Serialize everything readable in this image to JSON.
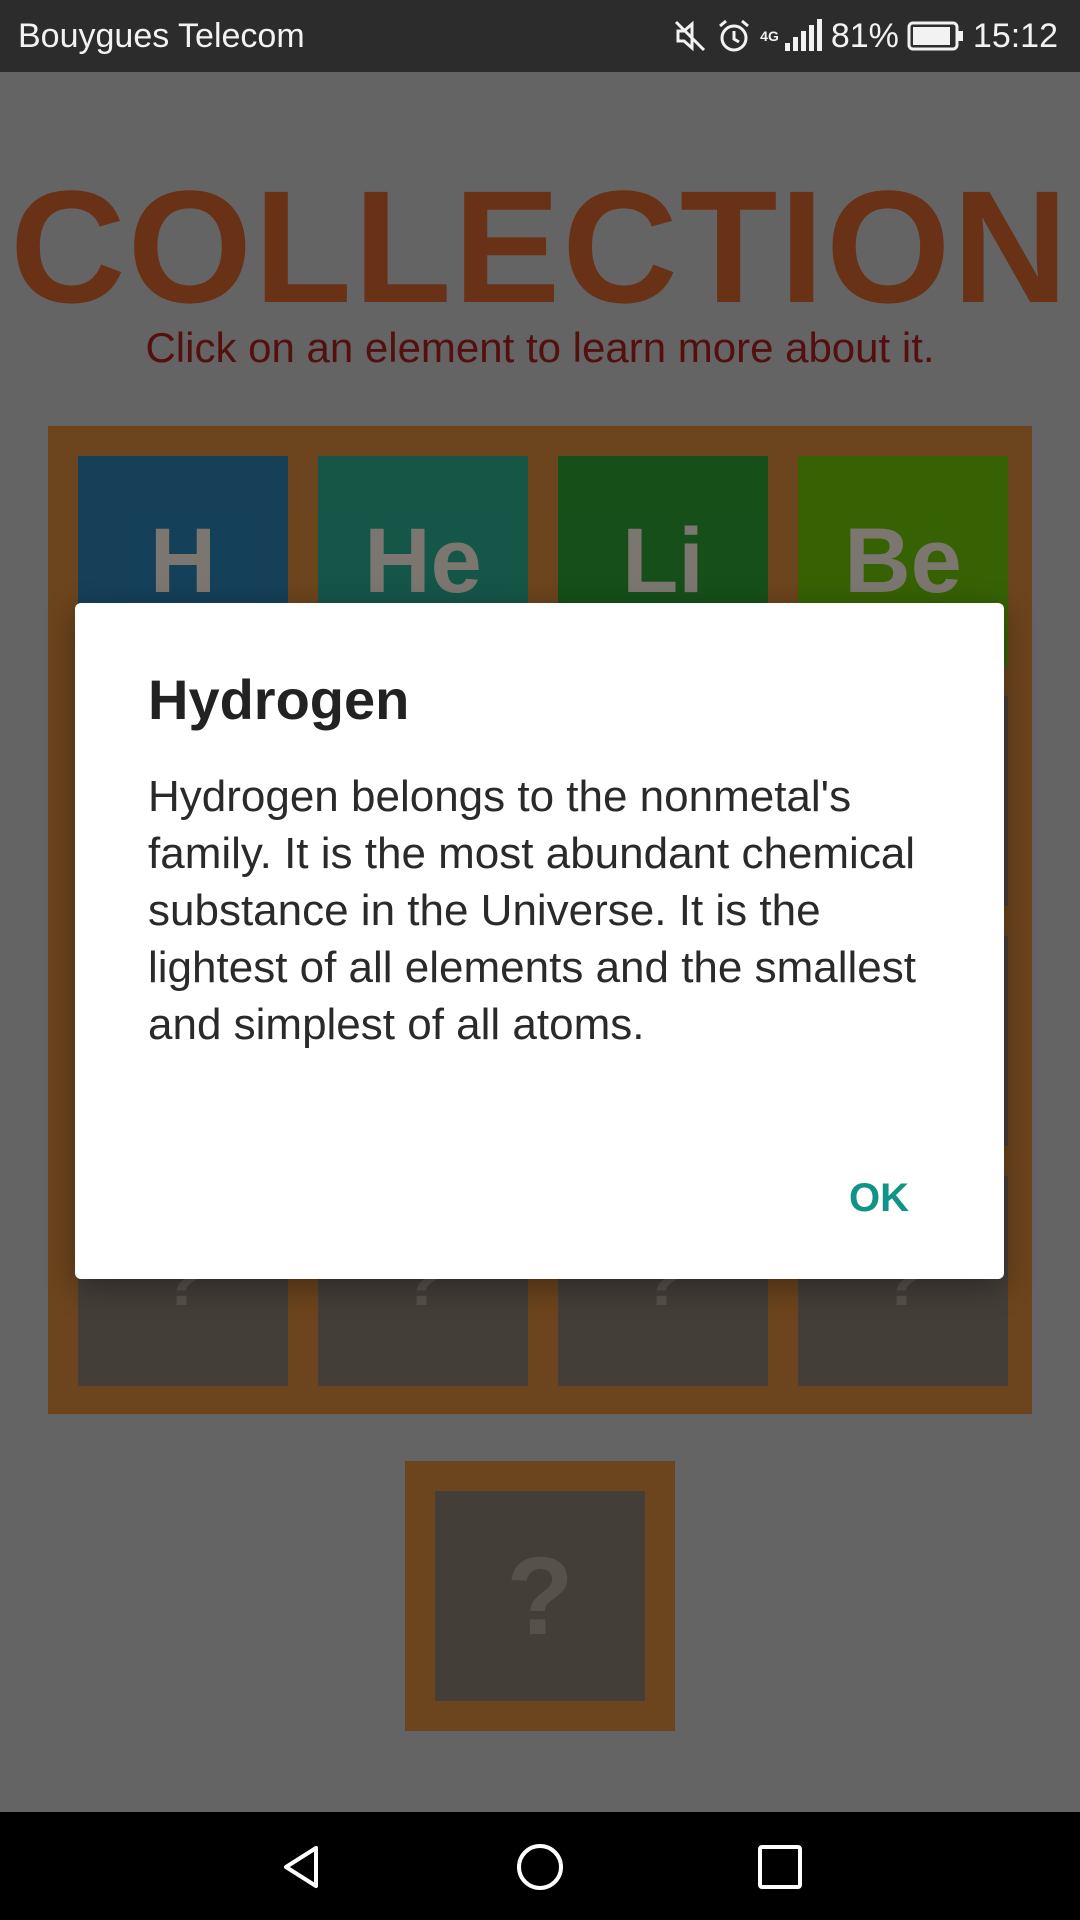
{
  "status_bar": {
    "carrier": "Bouygues Telecom",
    "network": "4G",
    "battery": "81%",
    "time": "15:12",
    "icons": [
      "mute-icon",
      "alarm-icon",
      "signal-icon",
      "battery-icon"
    ]
  },
  "screen": {
    "title": "COLLECTION",
    "subtitle": "Click on an element to learn more about it.",
    "elements": [
      {
        "symbol": "H",
        "color": "#0b7fc7"
      },
      {
        "symbol": "He",
        "color": "#0ab39f"
      },
      {
        "symbol": "Li",
        "color": "#0fa332"
      },
      {
        "symbol": "Be",
        "color": "#5ad000"
      }
    ],
    "unknown_symbol": "?",
    "colors": {
      "title": "#d2622a",
      "subtitle": "#a8211f",
      "frame": "#d9883a"
    }
  },
  "dialog": {
    "title": "Hydrogen",
    "body": "Hydrogen belongs to the nonmetal's family. It is the most abundant chemical substance in the Universe. It is the lightest of all elements and the smallest and simplest of all atoms.",
    "ok_label": "OK",
    "accent": "#109487"
  },
  "nav_bar": {
    "icons": [
      "back-icon",
      "home-icon",
      "recents-icon"
    ]
  }
}
